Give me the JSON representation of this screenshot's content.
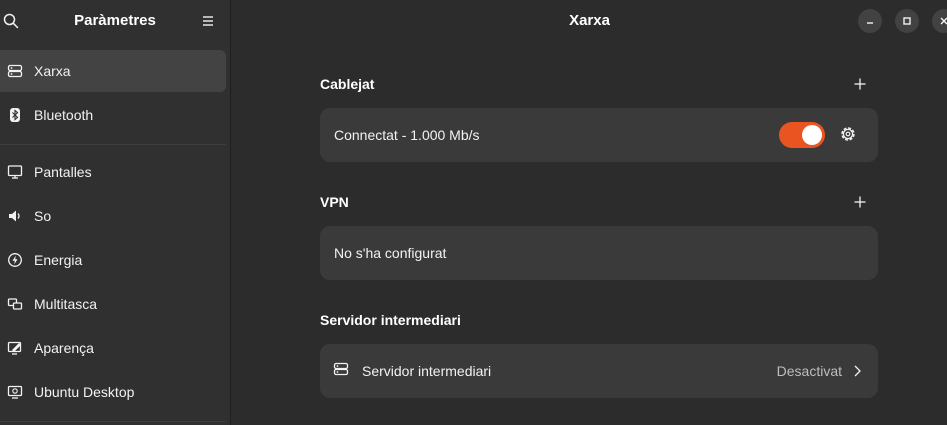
{
  "sidebar": {
    "title": "Paràmetres",
    "items": [
      {
        "label": "Xarxa",
        "icon": "network-icon"
      },
      {
        "label": "Bluetooth",
        "icon": "bluetooth-icon"
      },
      {
        "label": "Pantalles",
        "icon": "display-icon"
      },
      {
        "label": "So",
        "icon": "speaker-icon"
      },
      {
        "label": "Energia",
        "icon": "power-icon"
      },
      {
        "label": "Multitasca",
        "icon": "multitasking-icon"
      },
      {
        "label": "Aparença",
        "icon": "appearance-icon"
      },
      {
        "label": "Ubuntu Desktop",
        "icon": "ubuntu-desktop-icon"
      }
    ]
  },
  "window": {
    "title": "Xarxa"
  },
  "wired": {
    "title": "Cablejat",
    "connection_label": "Connectat - 1.000 Mb/s",
    "enabled": true
  },
  "vpn": {
    "title": "VPN",
    "status": "No s'ha configurat"
  },
  "proxy": {
    "title": "Servidor intermediari",
    "row_label": "Servidor intermediari",
    "status": "Desactivat"
  },
  "colors": {
    "accent": "#e95420",
    "background": "#2c2c2c",
    "card": "#3a3a3a"
  }
}
